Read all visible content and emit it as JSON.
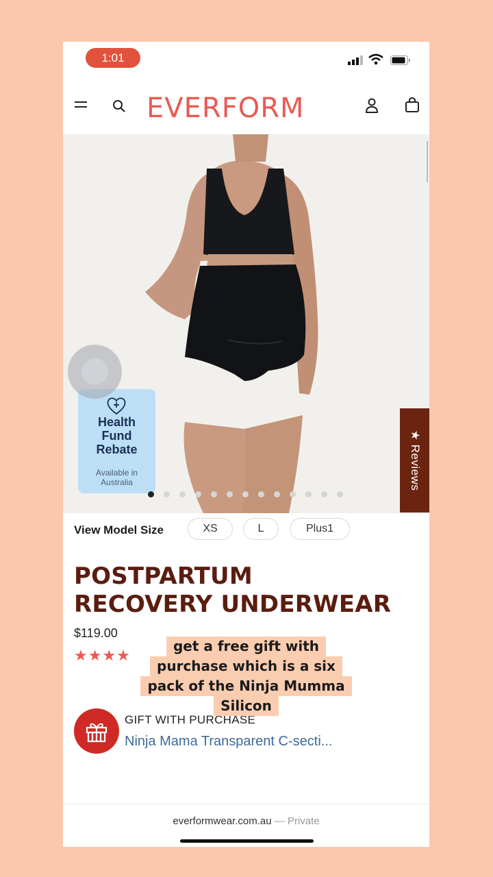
{
  "status_bar": {
    "time": "1:01"
  },
  "header": {
    "logo": "EVERFORM"
  },
  "badge": {
    "title_line1": "Health",
    "title_line2": "Fund",
    "title_line3": "Rebate",
    "sub_line1": "Available in",
    "sub_line2": "Australia"
  },
  "reviews_tab": {
    "label": "★ Reviews"
  },
  "carousel": {
    "count": 13,
    "active": 0
  },
  "model_size": {
    "label": "View Model Size",
    "options": [
      "XS",
      "L",
      "Plus1"
    ]
  },
  "product": {
    "title_line1": "POSTPARTUM",
    "title_line2": "RECOVERY UNDERWEAR",
    "price": "$119.00",
    "rating_stars": "★★★★"
  },
  "caption": {
    "line1": "get a free gift with",
    "line2": "purchase which is a six",
    "line3": "pack of the Ninja Mumma",
    "line4": "Silicon"
  },
  "gift": {
    "label": "GIFT WITH PURCHASE",
    "link": "Ninja Mama Transparent C-secti..."
  },
  "url_bar": {
    "domain": "everformwear.com.au",
    "separator": " — ",
    "mode": "Private"
  },
  "colors": {
    "brand": "#e85a52",
    "title": "#5a1d10",
    "reviews_tab": "#6b2410",
    "page_bg": "#fbc8ad"
  }
}
